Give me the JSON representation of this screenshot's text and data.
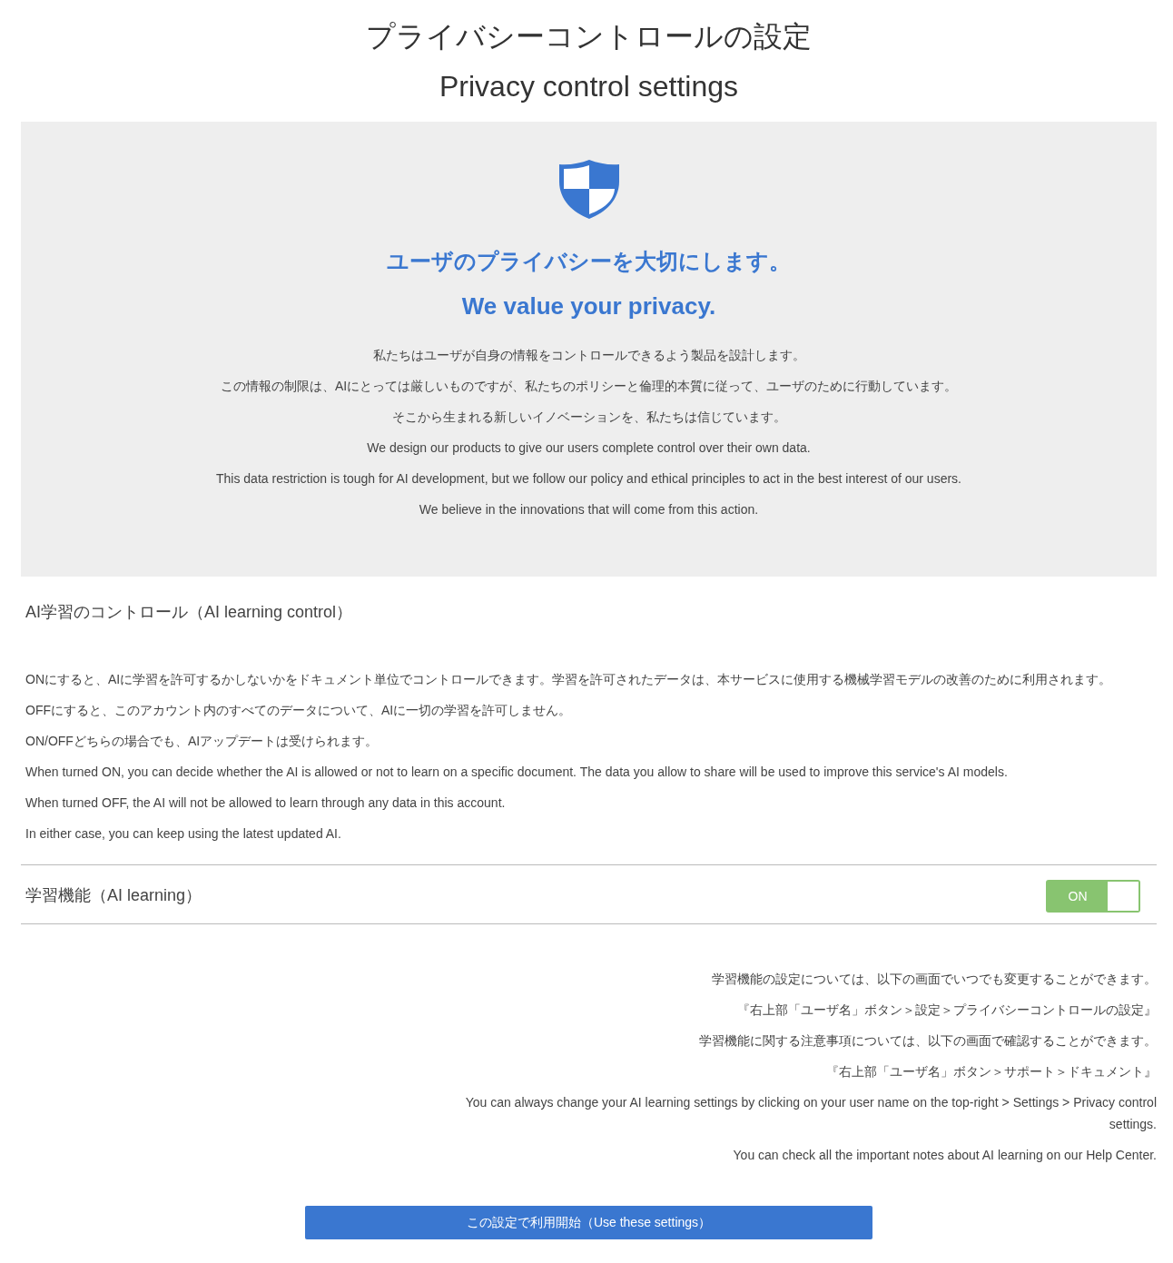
{
  "title_ja": "プライバシーコントロールの設定",
  "title_en": "Privacy control settings",
  "hero": {
    "heading_ja": "ユーザのプライバシーを大切にします。",
    "heading_en": "We value your privacy.",
    "paragraphs": [
      "私たちはユーザが自身の情報をコントロールできるよう製品を設計します。",
      "この情報の制限は、AIにとっては厳しいものですが、私たちのポリシーと倫理的本質に従って、ユーザのために行動しています。",
      "そこから生まれる新しいイノベーションを、私たちは信じています。",
      "We design our products to give our users complete control over their own data.",
      "This data restriction is tough for AI development, but we follow our policy and ethical principles to act in the best interest of our users.",
      "We believe in the innovations that will come from this action."
    ]
  },
  "section": {
    "title": "AI学習のコントロール（AI learning control）",
    "paragraphs": [
      "ONにすると、AIに学習を許可するかしないかをドキュメント単位でコントロールできます。学習を許可されたデータは、本サービスに使用する機械学習モデルの改善のために利用されます。",
      "OFFにすると、このアカウント内のすべてのデータについて、AIに一切の学習を許可しません。",
      "ON/OFFどちらの場合でも、AIアップデートは受けられます。",
      "When turned ON, you can decide whether the AI is allowed or not to learn on a specific document. The data you allow to share will be used to improve this service's AI models.",
      "When turned OFF, the AI will not be allowed to learn through any data in this account.",
      "In either case, you can keep using the latest updated AI."
    ]
  },
  "setting": {
    "label": "学習機能（AI learning）",
    "toggle_label": "ON",
    "on": true
  },
  "notes": [
    "学習機能の設定については、以下の画面でいつでも変更することができます。",
    "『右上部「ユーザ名」ボタン＞設定＞プライバシーコントロールの設定』",
    "学習機能に関する注意事項については、以下の画面で確認することができます。",
    "『右上部「ユーザ名」ボタン＞サポート＞ドキュメント』",
    "You can always change your AI learning settings by clicking on your user name on the top-right > Settings > Privacy control settings.",
    "You can check all the important notes about AI learning on our Help Center."
  ],
  "submit_button": "この設定で利用開始（Use these settings）"
}
